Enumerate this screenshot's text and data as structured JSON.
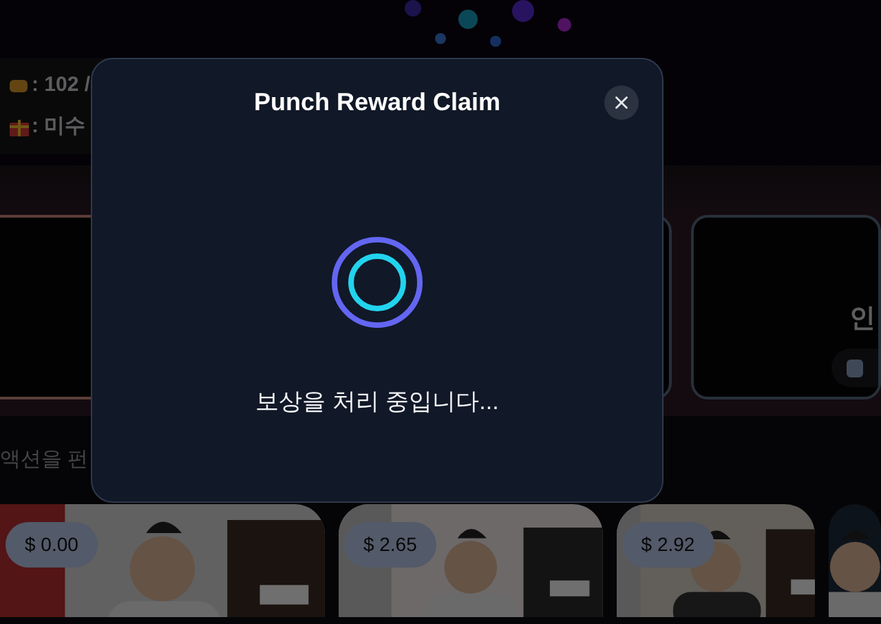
{
  "background": {
    "stats": [
      {
        "kind": "punch",
        "text": ": 102 /"
      },
      {
        "kind": "gift",
        "text": ": 미수"
      }
    ],
    "card_label": "인",
    "hint": "액션을 펀",
    "videos": [
      {
        "price": "$ 0.00"
      },
      {
        "price": "$ 2.65"
      },
      {
        "price": "$ 2.92"
      }
    ]
  },
  "modal": {
    "title": "Punch Reward Claim",
    "message": "보상을 처리 중입니다..."
  }
}
